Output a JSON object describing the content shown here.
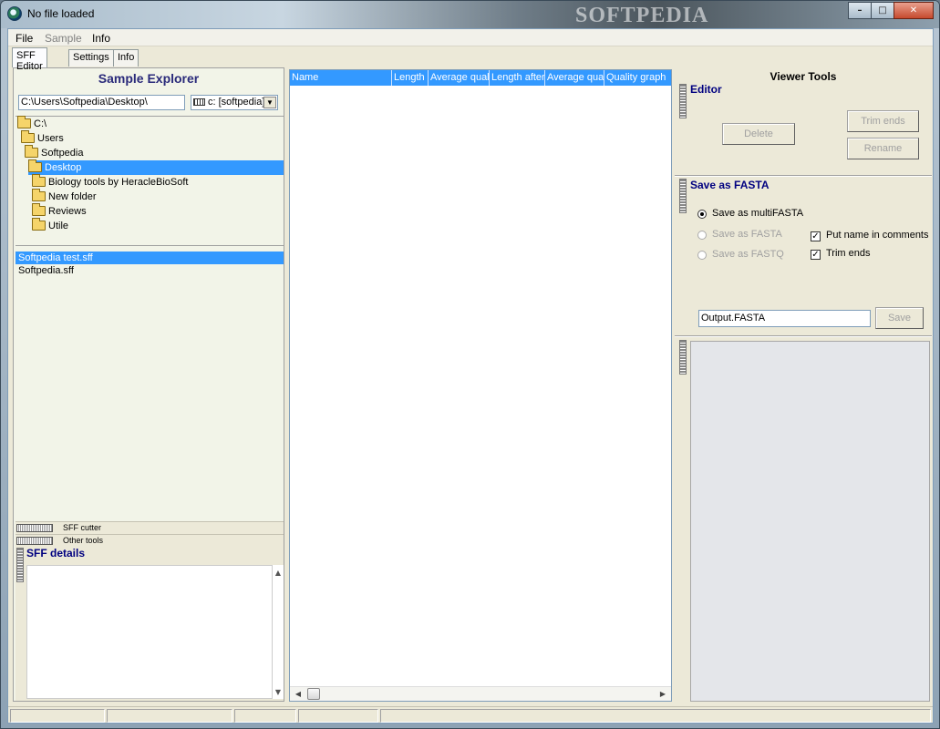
{
  "window": {
    "title": "No file loaded",
    "watermark": "SOFTPEDIA"
  },
  "menu": {
    "file": "File",
    "sample": "Sample",
    "info": "Info"
  },
  "tabs": {
    "sff_editor": "SFF Editor",
    "settings": "Settings",
    "info": "Info"
  },
  "explorer": {
    "title": "Sample Explorer",
    "path": "C:\\Users\\Softpedia\\Desktop\\",
    "drive": "c: [softpedia]",
    "tree": [
      "C:\\",
      "Users",
      "Softpedia",
      "Desktop",
      "Biology tools by HeracleBioSoft",
      "New folder",
      "Reviews",
      "Utile"
    ],
    "selected_folder": "Desktop",
    "files": [
      "Softpedia test.sff",
      "Softpedia.sff"
    ],
    "selected_file": "Softpedia test.sff"
  },
  "tools": {
    "cutter": "SFF cutter",
    "other": "Other tools"
  },
  "details": {
    "title": "SFF details"
  },
  "grid": {
    "columns": [
      "Name",
      "Length",
      "Average qual",
      "Length after",
      "Average qual",
      "Quality graph"
    ]
  },
  "viewer": {
    "title": "Viewer Tools",
    "editor": {
      "title": "Editor",
      "delete": "Delete",
      "trim_ends": "Trim ends",
      "rename": "Rename"
    },
    "fasta": {
      "title": "Save as FASTA",
      "opt_multi": "Save as multiFASTA",
      "opt_fasta": "Save as FASTA",
      "opt_fastq": "Save as FASTQ",
      "chk_name": "Put name in comments",
      "chk_trim": "Trim ends",
      "output": "Output.FASTA",
      "save": "Save"
    }
  },
  "colors": {
    "selection": "#3399ff",
    "section_title": "#000080",
    "panel_bg": "#f2f4e8"
  }
}
